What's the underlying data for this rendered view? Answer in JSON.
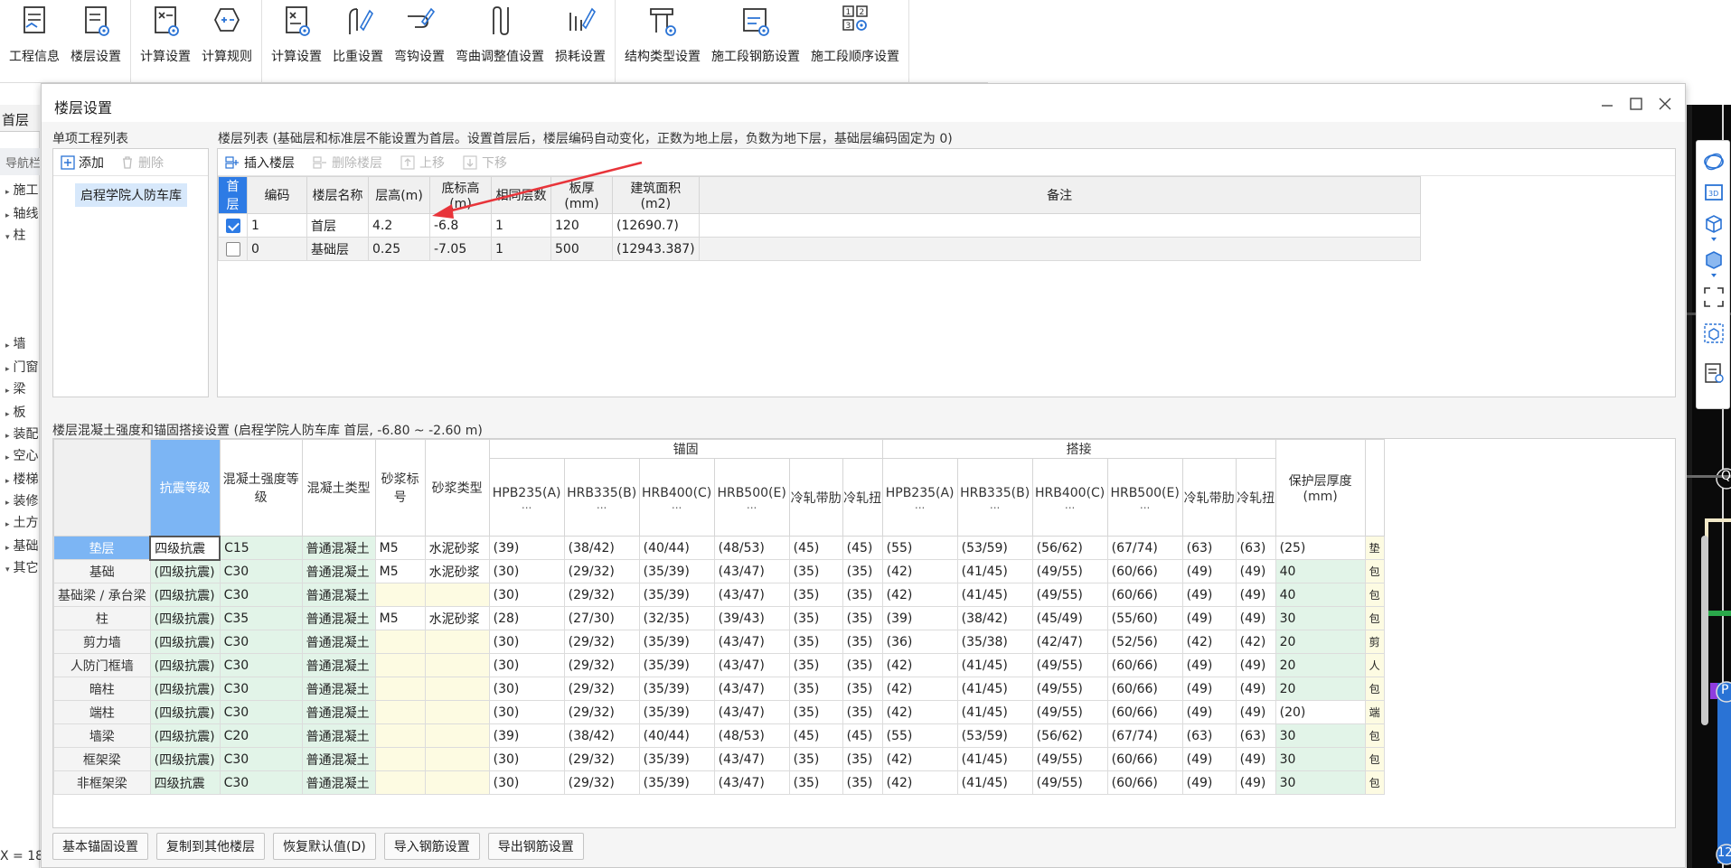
{
  "toolbar": {
    "groups": [
      [
        {
          "label": "工程信息",
          "icon": "project-info-icon"
        },
        {
          "label": "楼层设置",
          "icon": "floor-settings-icon"
        }
      ],
      [
        {
          "label": "计算设置",
          "icon": "calc-settings-icon"
        },
        {
          "label": "计算规则",
          "icon": "calc-rules-icon"
        }
      ],
      [
        {
          "label": "计算设置",
          "icon": "rebar-calc-settings-icon"
        },
        {
          "label": "比重设置",
          "icon": "weight-settings-icon"
        },
        {
          "label": "弯钩设置",
          "icon": "hook-settings-icon"
        },
        {
          "label": "弯曲调整值设置",
          "icon": "bend-adjust-icon"
        },
        {
          "label": "损耗设置",
          "icon": "loss-settings-icon"
        }
      ],
      [
        {
          "label": "结构类型设置",
          "icon": "structure-type-icon"
        },
        {
          "label": "施工段钢筋设置",
          "icon": "segment-rebar-icon"
        },
        {
          "label": "施工段顺序设置",
          "icon": "segment-order-icon"
        }
      ]
    ]
  },
  "left_panel": {
    "tab": "首层",
    "nav": "导航栏",
    "items": [
      "施工",
      "轴线",
      "柱",
      "墙",
      "门窗",
      "梁",
      "板",
      "装配",
      "空心",
      "楼梯",
      "装修",
      "土方",
      "基础",
      "其它"
    ],
    "coord": "X = 18"
  },
  "dialog": {
    "title": "楼层设置",
    "project_section_label": "单项工程列表",
    "add_label": "添加",
    "delete_label": "删除",
    "project_item": "启程学院人防车库",
    "floor_section_label": "楼层列表 (基础层和标准层不能设置为首层。设置首层后，楼层编码自动变化，正数为地上层，负数为地下层，基础层编码固定为 0)",
    "insert_floor": "插入楼层",
    "delete_floor": "删除楼层",
    "move_up": "上移",
    "move_down": "下移",
    "floor_columns": [
      "首层",
      "编码",
      "楼层名称",
      "层高(m)",
      "底标高(m)",
      "相同层数",
      "板厚(mm)",
      "建筑面积(m2)",
      "备注"
    ],
    "floor_rows": [
      {
        "checked": true,
        "cells": [
          "1",
          "首层",
          "4.2",
          "-6.8",
          "1",
          "120",
          "(12690.7)",
          ""
        ]
      },
      {
        "checked": false,
        "cells": [
          "0",
          "基础层",
          "0.25",
          "-7.05",
          "1",
          "500",
          "(12943.387)",
          ""
        ]
      }
    ],
    "mix_section_label": "楼层混凝土强度和锚固搭接设置 (启程学院人防车库 首层, -6.80 ~ -2.60 m)",
    "mix_headers": {
      "seismic": "抗震等级",
      "concrete_grade": "混凝土强度等级",
      "concrete_type": "混凝土类型",
      "mortar_grade": "砂浆标号",
      "mortar_type": "砂浆类型",
      "anchorage": "锚固",
      "lap": "搭接",
      "cover": "保护层厚度(mm)",
      "rebar": [
        "HPB235(A)",
        "HRB335(B)",
        "HRB400(C)",
        "HRB500(E)",
        "冷轧带肋",
        "冷轧扭"
      ],
      "ellipsis": "..."
    },
    "mix_rows": [
      {
        "name": "垫层",
        "seismic": "四级抗震",
        "grade": "C15",
        "ctype": "普通混凝土",
        "mgrade": "M5",
        "mtype": "水泥砂浆",
        "anchor": [
          "(39)",
          "(38/42)",
          "(40/44)",
          "(48/53)",
          "(45)",
          "(45)"
        ],
        "lap": [
          "(55)",
          "(53/59)",
          "(56/62)",
          "(67/74)",
          "(63)",
          "(63)"
        ],
        "cover": "(25)",
        "note": "垫"
      },
      {
        "name": "基础",
        "seismic": "(四级抗震)",
        "grade": "C30",
        "ctype": "普通混凝土",
        "mgrade": "M5",
        "mtype": "水泥砂浆",
        "anchor": [
          "(30)",
          "(29/32)",
          "(35/39)",
          "(43/47)",
          "(35)",
          "(35)"
        ],
        "lap": [
          "(42)",
          "(41/45)",
          "(49/55)",
          "(60/66)",
          "(49)",
          "(49)"
        ],
        "cover": "40",
        "note": "包"
      },
      {
        "name": "基础梁 / 承台梁",
        "seismic": "(四级抗震)",
        "grade": "C30",
        "ctype": "普通混凝土",
        "mgrade": "",
        "mtype": "",
        "anchor": [
          "(30)",
          "(29/32)",
          "(35/39)",
          "(43/47)",
          "(35)",
          "(35)"
        ],
        "lap": [
          "(42)",
          "(41/45)",
          "(49/55)",
          "(60/66)",
          "(49)",
          "(49)"
        ],
        "cover": "40",
        "note": "包"
      },
      {
        "name": "柱",
        "seismic": "(四级抗震)",
        "grade": "C35",
        "ctype": "普通混凝土",
        "mgrade": "M5",
        "mtype": "水泥砂浆",
        "anchor": [
          "(28)",
          "(27/30)",
          "(32/35)",
          "(39/43)",
          "(35)",
          "(35)"
        ],
        "lap": [
          "(39)",
          "(38/42)",
          "(45/49)",
          "(55/60)",
          "(49)",
          "(49)"
        ],
        "cover": "30",
        "note": "包"
      },
      {
        "name": "剪力墙",
        "seismic": "(四级抗震)",
        "grade": "C30",
        "ctype": "普通混凝土",
        "mgrade": "",
        "mtype": "",
        "anchor": [
          "(30)",
          "(29/32)",
          "(35/39)",
          "(43/47)",
          "(35)",
          "(35)"
        ],
        "lap": [
          "(36)",
          "(35/38)",
          "(42/47)",
          "(52/56)",
          "(42)",
          "(42)"
        ],
        "cover": "20",
        "note": "剪"
      },
      {
        "name": "人防门框墙",
        "seismic": "(四级抗震)",
        "grade": "C30",
        "ctype": "普通混凝土",
        "mgrade": "",
        "mtype": "",
        "anchor": [
          "(30)",
          "(29/32)",
          "(35/39)",
          "(43/47)",
          "(35)",
          "(35)"
        ],
        "lap": [
          "(42)",
          "(41/45)",
          "(49/55)",
          "(60/66)",
          "(49)",
          "(49)"
        ],
        "cover": "20",
        "note": "人"
      },
      {
        "name": "暗柱",
        "seismic": "(四级抗震)",
        "grade": "C30",
        "ctype": "普通混凝土",
        "mgrade": "",
        "mtype": "",
        "anchor": [
          "(30)",
          "(29/32)",
          "(35/39)",
          "(43/47)",
          "(35)",
          "(35)"
        ],
        "lap": [
          "(42)",
          "(41/45)",
          "(49/55)",
          "(60/66)",
          "(49)",
          "(49)"
        ],
        "cover": "20",
        "note": "包"
      },
      {
        "name": "端柱",
        "seismic": "(四级抗震)",
        "grade": "C30",
        "ctype": "普通混凝土",
        "mgrade": "",
        "mtype": "",
        "anchor": [
          "(30)",
          "(29/32)",
          "(35/39)",
          "(43/47)",
          "(35)",
          "(35)"
        ],
        "lap": [
          "(42)",
          "(41/45)",
          "(49/55)",
          "(60/66)",
          "(49)",
          "(49)"
        ],
        "cover": "(20)",
        "note": "端"
      },
      {
        "name": "墙梁",
        "seismic": "(四级抗震)",
        "grade": "C20",
        "ctype": "普通混凝土",
        "mgrade": "",
        "mtype": "",
        "anchor": [
          "(39)",
          "(38/42)",
          "(40/44)",
          "(48/53)",
          "(45)",
          "(45)"
        ],
        "lap": [
          "(55)",
          "(53/59)",
          "(56/62)",
          "(67/74)",
          "(63)",
          "(63)"
        ],
        "cover": "30",
        "note": "包"
      },
      {
        "name": "框架梁",
        "seismic": "(四级抗震)",
        "grade": "C30",
        "ctype": "普通混凝土",
        "mgrade": "",
        "mtype": "",
        "anchor": [
          "(30)",
          "(29/32)",
          "(35/39)",
          "(43/47)",
          "(35)",
          "(35)"
        ],
        "lap": [
          "(42)",
          "(41/45)",
          "(49/55)",
          "(60/66)",
          "(49)",
          "(49)"
        ],
        "cover": "30",
        "note": "包"
      },
      {
        "name": "非框架梁",
        "seismic": "四级抗震",
        "grade": "C30",
        "ctype": "普通混凝土",
        "mgrade": "",
        "mtype": "",
        "anchor": [
          "(30)",
          "(29/32)",
          "(35/39)",
          "(43/47)",
          "(35)",
          "(35)"
        ],
        "lap": [
          "(42)",
          "(41/45)",
          "(49/55)",
          "(60/66)",
          "(49)",
          "(49)"
        ],
        "cover": "30",
        "note": "包"
      }
    ],
    "bottom_buttons": [
      "基本锚固设置",
      "复制到其他楼层",
      "恢复默认值(D)",
      "导入钢筋设置",
      "导出钢筋设置"
    ]
  },
  "canvas_labels": {
    "q": "Q",
    "p": "P",
    "n": "12"
  },
  "colors": {
    "accent": "#2d7be5",
    "header_blue": "#7cb5f4",
    "arrow": "#e8343a",
    "green_cell": "#e2f4e8",
    "yellow_cell": "#fdfbe2"
  }
}
